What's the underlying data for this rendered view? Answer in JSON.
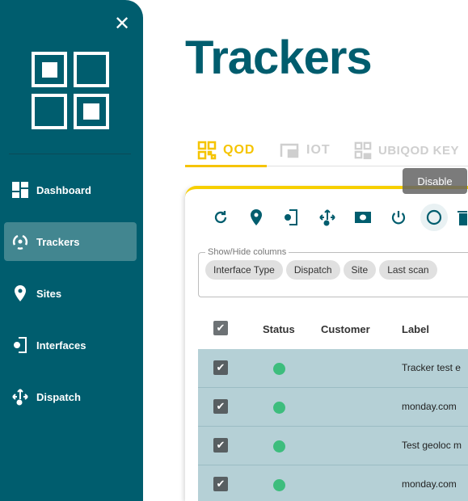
{
  "sidebar": {
    "close_icon": "close-icon",
    "items": [
      {
        "label": "Dashboard",
        "icon": "dashboard-icon"
      },
      {
        "label": "Trackers",
        "icon": "trackers-icon",
        "active": true
      },
      {
        "label": "Sites",
        "icon": "location-pin-icon"
      },
      {
        "label": "Interfaces",
        "icon": "interface-icon"
      },
      {
        "label": "Dispatch",
        "icon": "dispatch-icon"
      }
    ]
  },
  "page": {
    "title": "Trackers"
  },
  "tabs": [
    {
      "label": "QOD",
      "active": true
    },
    {
      "label": "IOT"
    },
    {
      "label": "UBIQOD KEY"
    }
  ],
  "tooltip": "Disable",
  "toolbar": [
    "refresh-icon",
    "location-pin-icon",
    "interface-icon",
    "dispatch-icon",
    "money-icon",
    "power-icon",
    "disable-circle-icon",
    "delete-icon"
  ],
  "columns_filter": {
    "legend": "Show/Hide columns",
    "chips": [
      "Interface Type",
      "Dispatch",
      "Site",
      "Last scan"
    ]
  },
  "table": {
    "headers": [
      "Status",
      "Customer",
      "Label"
    ],
    "rows": [
      {
        "label": "Tracker test e",
        "status": "active",
        "checked": true
      },
      {
        "label": "monday.com",
        "status": "active",
        "checked": true
      },
      {
        "label": "Test geoloc m",
        "status": "active",
        "checked": true
      },
      {
        "label": "monday.com",
        "status": "active",
        "checked": true
      }
    ]
  },
  "colors": {
    "sidebar": "#005d6e",
    "accent": "#f5c400",
    "status_active": "#3dbd7d",
    "row_selected": "#b5d0d6"
  }
}
